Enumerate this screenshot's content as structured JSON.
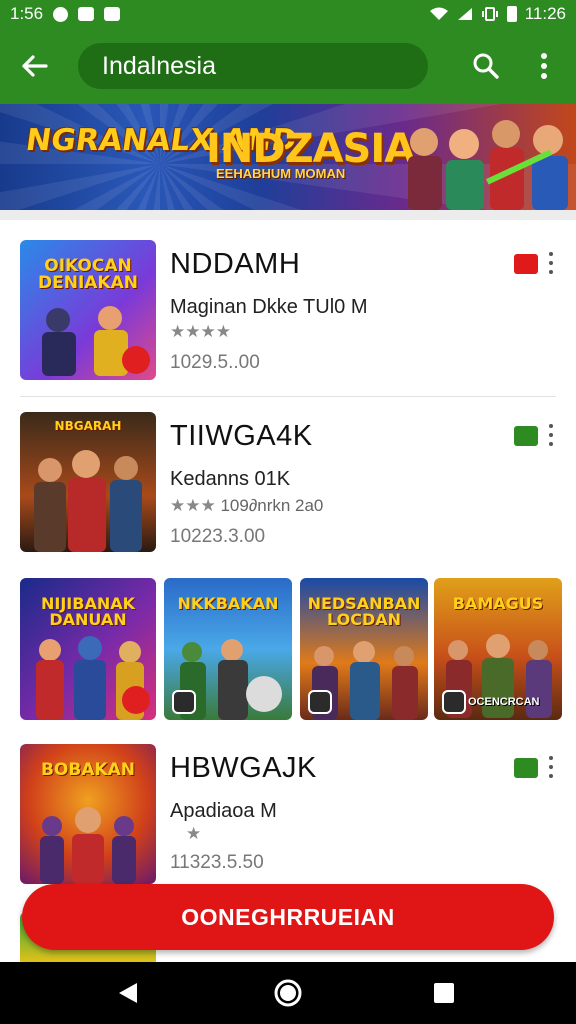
{
  "status_bar": {
    "time_left": "1:56",
    "time_right": "11:26"
  },
  "app_bar": {
    "title": "Indalnesia",
    "back_icon": "arrow-back-icon",
    "search_icon": "search-icon",
    "more_icon": "more-vert-icon"
  },
  "banner": {
    "left_text": "NGRANALX AND",
    "title": "INDZASIA",
    "subtitle": "EEHABHUM MOMAN"
  },
  "apps": [
    {
      "thumb_title": "OIKOCAN DENIAKAN",
      "name": "NDDAMH",
      "desc": "Maginan Dkke TUl0 M",
      "stars": "★★★★",
      "stars_text": "",
      "price": "1029.5..00",
      "chat_color": "#e01a1a"
    },
    {
      "thumb_title": "NBGARAH",
      "name": "TIIWGA4K",
      "desc": "Kedanns 01K",
      "stars": "★★★",
      "stars_text": "109∂nrkn 2a0",
      "price": "10223.3.00",
      "chat_color": "#2e8b22"
    },
    {
      "thumb_title": "BOBAKAN",
      "name": "HBWGAJK",
      "desc": "Apadiaoa M",
      "stars": "★",
      "stars_text": "",
      "price": "11323.5.50",
      "chat_color": "#2e8b22"
    }
  ],
  "grid": [
    {
      "title": "NIJIBANAK DANUAN",
      "badge_text": ""
    },
    {
      "title": "NKKBAKAN",
      "badge_text": ""
    },
    {
      "title": "NEDSANBAN LOCDAN",
      "badge_text": ""
    },
    {
      "title": "BAMAGUS",
      "badge_text": "OCENCRCAN"
    }
  ],
  "fab": {
    "label": "OONEGHRRUEIAN"
  },
  "nav": {
    "back_icon": "nav-back-icon",
    "home_icon": "nav-home-icon",
    "recents_icon": "nav-recents-icon"
  },
  "colors": {
    "primary": "#2e8b22",
    "primary_dark": "#1f6e16",
    "accent": "#e01616"
  }
}
